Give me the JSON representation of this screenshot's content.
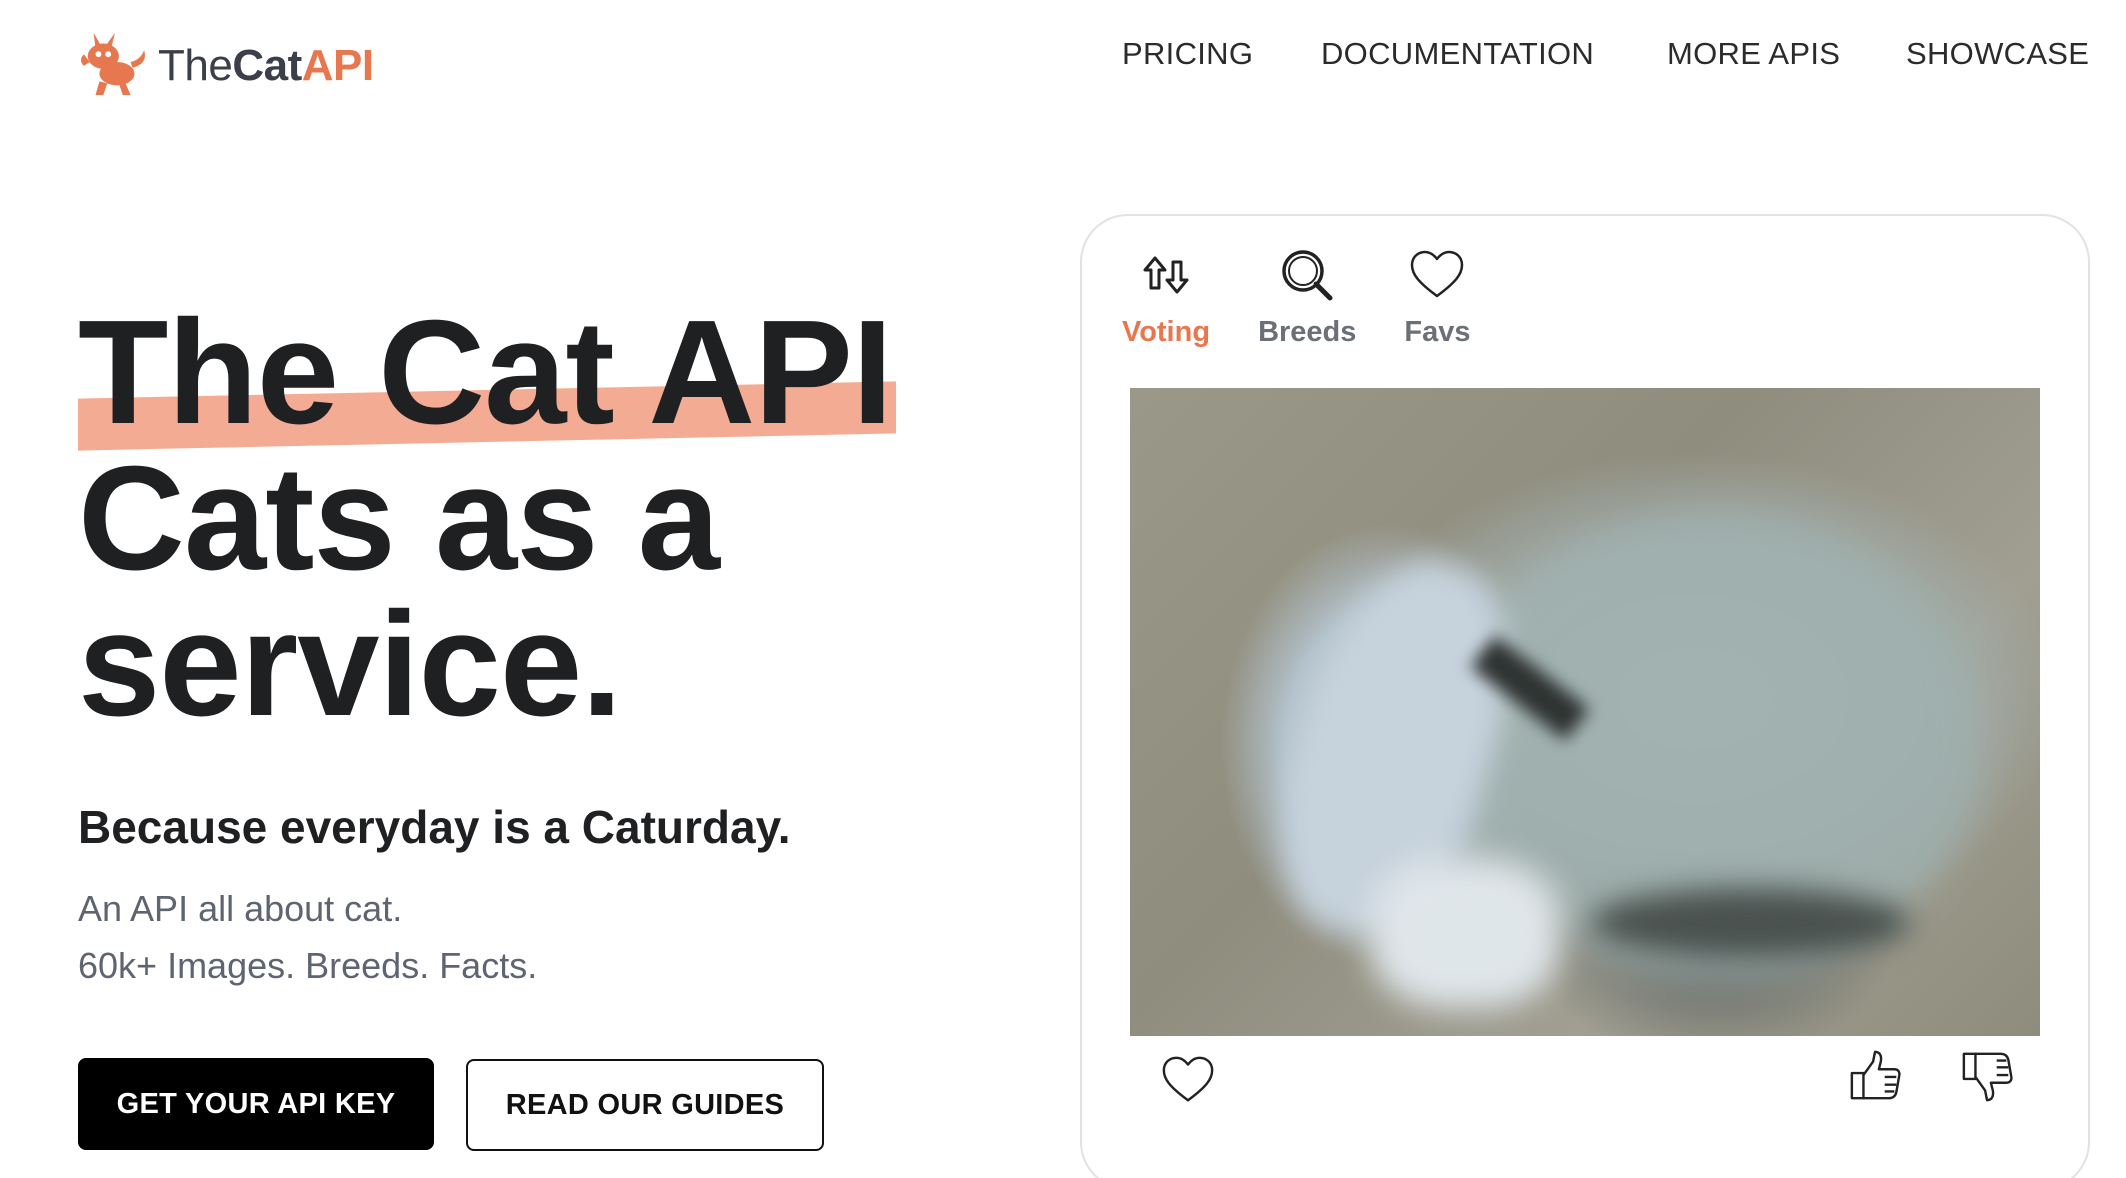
{
  "header": {
    "logo": {
      "the": "The",
      "cat": "Cat",
      "api": "API"
    },
    "nav": [
      "PRICING",
      "DOCUMENTATION",
      "MORE APIS",
      "SHOWCASE"
    ]
  },
  "hero": {
    "title_line1": "The Cat API",
    "title_line2": "Cats as a",
    "title_line3": "service.",
    "tagline": "Because everyday is a Caturday.",
    "desc_line1": "An API all about cat.",
    "desc_line2": "60k+ Images. Breeds. Facts.",
    "primary_button": "GET YOUR API KEY",
    "secondary_button": "READ OUR GUIDES"
  },
  "card": {
    "tabs": [
      {
        "label": "Voting",
        "icon": "vote-arrows-icon",
        "active": true
      },
      {
        "label": "Breeds",
        "icon": "search-icon",
        "active": false
      },
      {
        "label": "Favs",
        "icon": "heart-icon",
        "active": false
      }
    ],
    "image": "blurry gray cat photo",
    "actions": [
      "heart-icon",
      "thumbs-up-icon",
      "thumbs-down-icon"
    ]
  },
  "colors": {
    "accent": "#e7774e",
    "highlight": "#f4ab94",
    "text": "#1f2022",
    "muted": "#5e6470"
  }
}
